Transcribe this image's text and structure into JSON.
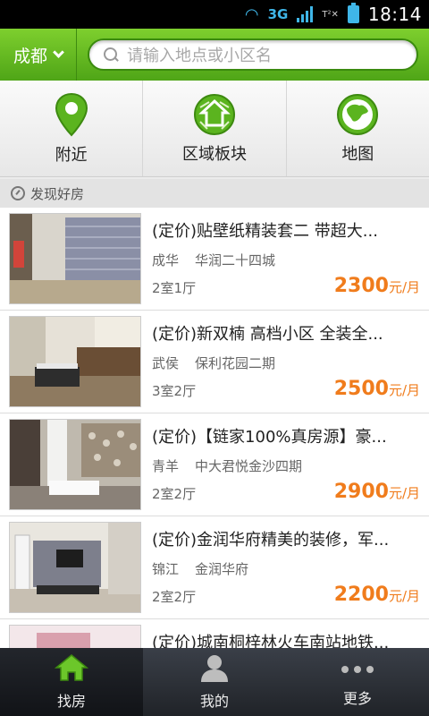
{
  "status_bar": {
    "network": "3G",
    "time": "18:14"
  },
  "header": {
    "city": "成都",
    "search_placeholder": "请输入地点或小区名"
  },
  "categories": [
    {
      "label": "附近",
      "icon": "location-pin-icon"
    },
    {
      "label": "区域板块",
      "icon": "region-block-icon"
    },
    {
      "label": "地图",
      "icon": "globe-map-icon"
    }
  ],
  "section_title": "发现好房",
  "listings": [
    {
      "title": "(定价)贴壁纸精装套二 带超大...",
      "district": "成华",
      "community": "华润二十四城",
      "layout": "2室1厅",
      "price": "2300",
      "unit": "元/月"
    },
    {
      "title": "(定价)新双楠 高档小区 全装全...",
      "district": "武侯",
      "community": "保利花园二期",
      "layout": "3室2厅",
      "price": "2500",
      "unit": "元/月"
    },
    {
      "title": "(定价)【链家100%真房源】豪...",
      "district": "青羊",
      "community": "中大君悦金沙四期",
      "layout": "2室2厅",
      "price": "2900",
      "unit": "元/月"
    },
    {
      "title": "(定价)金润华府精美的装修，军...",
      "district": "锦江",
      "community": "金润华府",
      "layout": "2室2厅",
      "price": "2200",
      "unit": "元/月"
    },
    {
      "title": "(定价)城南桐梓林火车南站地铁...",
      "district": "",
      "community": "",
      "layout": "",
      "price": "",
      "unit": ""
    }
  ],
  "tabs": [
    {
      "label": "找房",
      "icon": "home-icon"
    },
    {
      "label": "我的",
      "icon": "user-icon"
    },
    {
      "label": "更多",
      "icon": "more-icon"
    }
  ],
  "colors": {
    "accent_green": "#5bb41f",
    "price_orange": "#f07c1c"
  }
}
